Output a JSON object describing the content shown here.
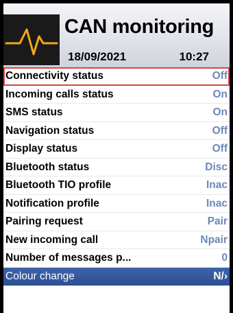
{
  "header": {
    "title": "CAN monitoring",
    "date": "18/09/2021",
    "time": "10:27",
    "logo_icon": "pulse-waveform-icon"
  },
  "colors": {
    "value_text": "#6c88b8",
    "selected_row": "#2c4f93",
    "focus_outline": "#d64545",
    "logo_line": "#f2a81d"
  },
  "items": [
    {
      "label": "Connectivity status",
      "value": "Off"
    },
    {
      "label": "Incoming calls status",
      "value": "On"
    },
    {
      "label": "SMS status",
      "value": "On"
    },
    {
      "label": "Navigation status",
      "value": "Off"
    },
    {
      "label": "Display status",
      "value": "Off"
    },
    {
      "label": "Bluetooth status",
      "value": "Disc"
    },
    {
      "label": "Bluetooth TIO profile",
      "value": "Inac"
    },
    {
      "label": "Notification profile",
      "value": "Inac"
    },
    {
      "label": "Pairing request",
      "value": "Pair"
    },
    {
      "label": "New incoming call",
      "value": "Npair"
    },
    {
      "label": "Number of messages p...",
      "value": "0"
    },
    {
      "label": "Colour change",
      "value": "N/",
      "chevron": "›"
    }
  ]
}
